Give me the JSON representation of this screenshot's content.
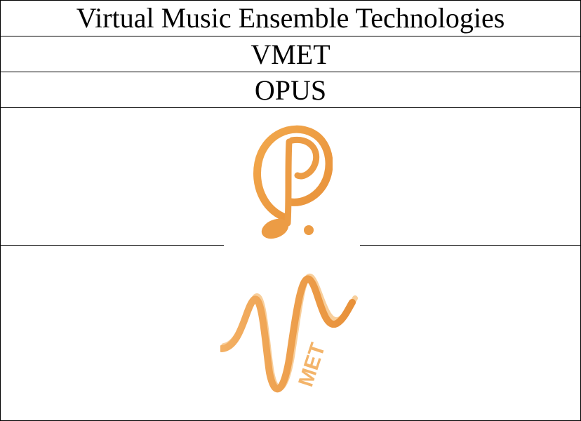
{
  "table": {
    "rows": [
      {
        "text": "Virtual Music Ensemble Technologies"
      },
      {
        "text": "VMET"
      },
      {
        "text": "OPUS"
      }
    ]
  },
  "logos": {
    "opus_logo": {
      "depicts": "music-note-circle-P",
      "color": "#F0A040"
    },
    "vmet_logo": {
      "depicts": "waveform-V",
      "text": "MET",
      "color": "#F0A040"
    }
  },
  "colors": {
    "accent": "#F0A040",
    "border": "#000000",
    "background": "#FFFFFF"
  }
}
